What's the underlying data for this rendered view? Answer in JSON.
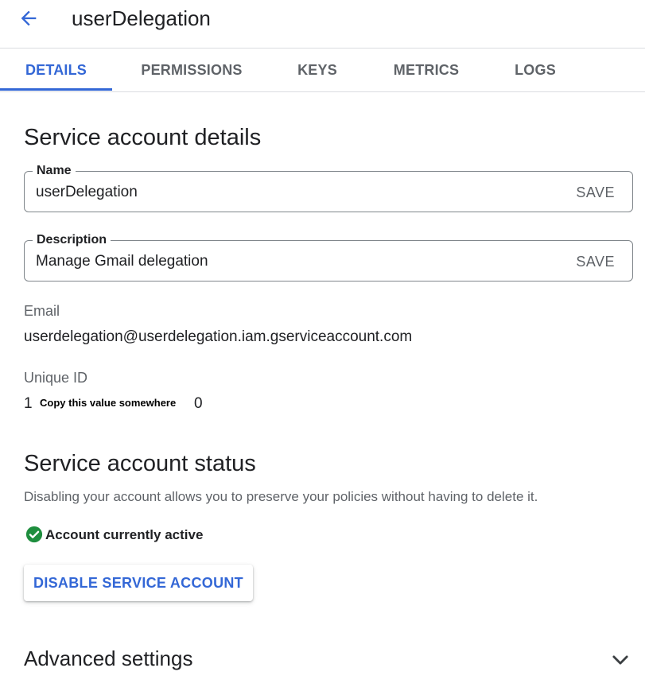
{
  "header": {
    "title": "userDelegation",
    "back_icon": "arrow-back-icon"
  },
  "tabs": [
    {
      "label": "DETAILS",
      "active": true
    },
    {
      "label": "PERMISSIONS",
      "active": false
    },
    {
      "label": "KEYS",
      "active": false
    },
    {
      "label": "METRICS",
      "active": false
    },
    {
      "label": "LOGS",
      "active": false
    }
  ],
  "details": {
    "heading": "Service account details",
    "name_field": {
      "label": "Name",
      "value": "userDelegation",
      "save_label": "SAVE"
    },
    "description_field": {
      "label": "Description",
      "value": "Manage Gmail delegation",
      "save_label": "SAVE"
    },
    "email": {
      "label": "Email",
      "value": "userdelegation@userdelegation.iam.gserviceaccount.com"
    },
    "unique_id": {
      "label": "Unique ID",
      "value_start": "1",
      "value_end": "0",
      "annotation": "Copy this value somewhere"
    }
  },
  "status": {
    "heading": "Service account status",
    "description": "Disabling your account allows you to preserve your policies without having to delete it.",
    "state_text": "Account currently active",
    "state_icon": "check-circle-icon",
    "state_color": "#1e8e3e",
    "disable_button": "DISABLE SERVICE ACCOUNT"
  },
  "advanced": {
    "title": "Advanced settings",
    "expand_icon": "chevron-down-icon"
  },
  "colors": {
    "accent": "#3367d6",
    "text": "#202124",
    "secondary": "#5f6368",
    "divider": "#dadce0"
  }
}
